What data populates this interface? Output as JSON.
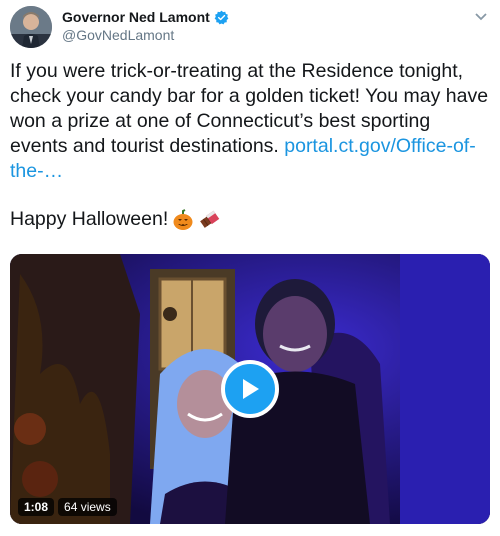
{
  "author": {
    "display_name": "Governor Ned Lamont",
    "handle": "@GovNedLamont",
    "verified_icon": "verified-badge-icon",
    "verified_color": "#1da1f2"
  },
  "tweet": {
    "text": "If you were trick-or-treating at the Residence tonight, check your candy bar for a golden ticket! You may have won a prize at one of Connecticut’s best sporting events and tourist destinations. ",
    "link": "portal.ct.gov/Office-of-the-…",
    "greeting": "Happy Halloween!",
    "emojis": [
      "pumpkin-icon",
      "chocolate-bar-icon"
    ],
    "link_color": "#1b95e0"
  },
  "video": {
    "duration": "1:08",
    "views": "64 views",
    "play_color": "#1da1f2"
  }
}
